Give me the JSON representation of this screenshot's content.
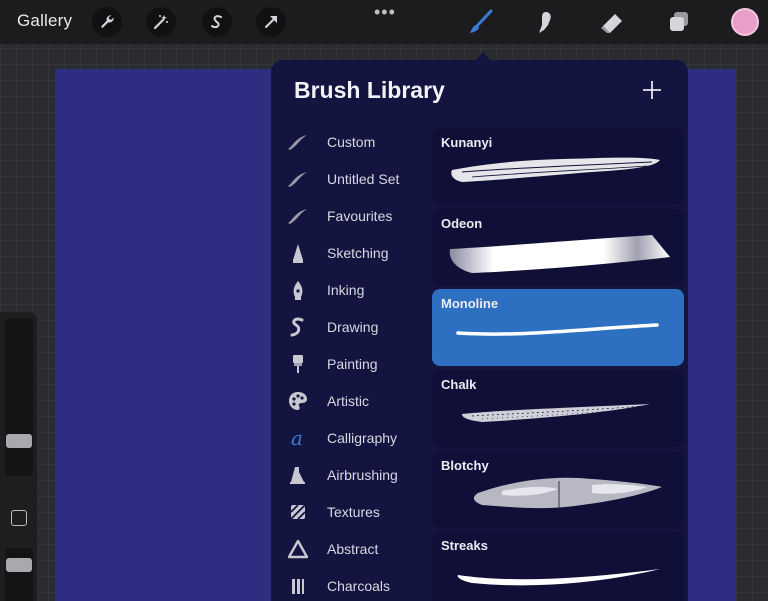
{
  "topbar": {
    "gallery_label": "Gallery",
    "tools": [
      "wrench-icon",
      "magic-wand-icon",
      "selection-icon",
      "transform-arrow-icon"
    ],
    "more_label": "•••",
    "right_tools": [
      "brush-icon",
      "smudge-icon",
      "eraser-icon",
      "layers-icon"
    ],
    "active_color": "#e89ec9"
  },
  "brush_library": {
    "title": "Brush Library",
    "categories": [
      {
        "label": "Custom",
        "icon": "stroke-icon"
      },
      {
        "label": "Untitled Set",
        "icon": "stroke-icon"
      },
      {
        "label": "Favourites",
        "icon": "stroke-icon"
      },
      {
        "label": "Sketching",
        "icon": "pencil-tip-icon"
      },
      {
        "label": "Inking",
        "icon": "pen-nib-icon"
      },
      {
        "label": "Drawing",
        "icon": "squiggle-icon"
      },
      {
        "label": "Painting",
        "icon": "paint-brush-icon"
      },
      {
        "label": "Artistic",
        "icon": "palette-icon"
      },
      {
        "label": "Calligraphy",
        "icon": "calligraphy-a-icon"
      },
      {
        "label": "Airbrushing",
        "icon": "airbrush-icon"
      },
      {
        "label": "Textures",
        "icon": "texture-icon"
      },
      {
        "label": "Abstract",
        "icon": "triangle-icon"
      },
      {
        "label": "Charcoals",
        "icon": "charcoal-icon"
      }
    ],
    "brushes": [
      {
        "name": "Kunanyi",
        "selected": false
      },
      {
        "name": "Odeon",
        "selected": false
      },
      {
        "name": "Monoline",
        "selected": true
      },
      {
        "name": "Chalk",
        "selected": false
      },
      {
        "name": "Blotchy",
        "selected": false
      },
      {
        "name": "Streaks",
        "selected": false
      }
    ]
  },
  "colors": {
    "canvas": "#2d2e82",
    "panel": "#141440",
    "selected_brush": "#2d6fc0",
    "accent_blue": "#3a7bd5"
  }
}
